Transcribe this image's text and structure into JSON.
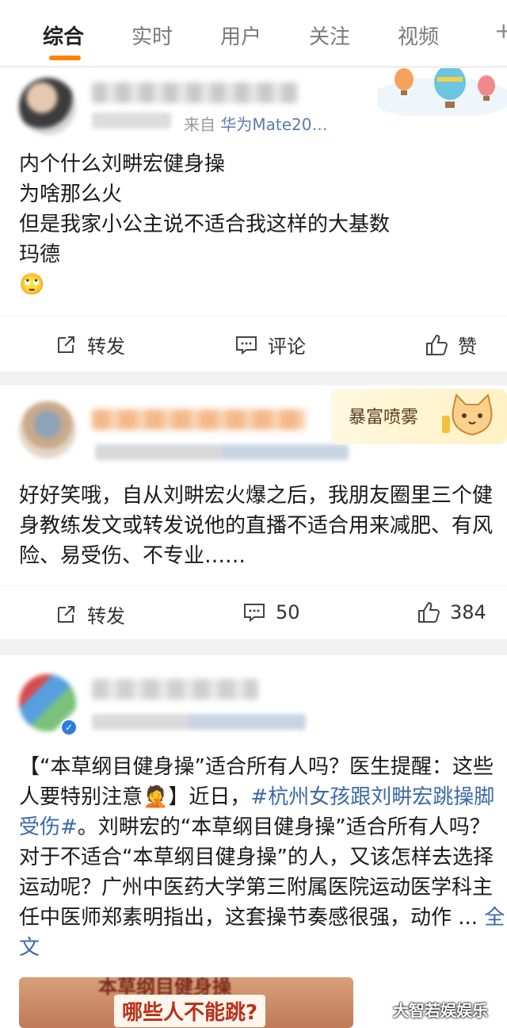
{
  "tabs": {
    "items": [
      {
        "label": "综合",
        "active": true
      },
      {
        "label": "实时",
        "active": false
      },
      {
        "label": "用户",
        "active": false
      },
      {
        "label": "关注",
        "active": false
      },
      {
        "label": "视频",
        "active": false
      }
    ],
    "accent": "#ff8200"
  },
  "posts": [
    {
      "meta_visible": "分钟前 · 来自 华为Mate20…",
      "meta_source": "华为Mate20…",
      "text": "内个什么刘畊宏健身操\n为啥那么火\n但是我家小公主说不适合我这样的大基数\n玛德",
      "emoji": "🙄",
      "decoration": "hot-air-balloons",
      "actions": {
        "repost": "转发",
        "comment": "评论",
        "like": "赞"
      }
    },
    {
      "text": "好好笑哦，自从刘畊宏火爆之后，我朋友圈里三个健身教练发文或转发说他的直播不适合用来减肥、有风险、易受伤、不专业……",
      "badge_text": "暴富喷雾",
      "actions": {
        "repost": "转发",
        "comment": "50",
        "like": "384"
      }
    },
    {
      "text_part1": "【“本草纲目健身操”适合所有人吗？医生提醒：这些人要特别注意",
      "text_emoji": "🤦",
      "text_part2": "】近日，",
      "hashtag": "#杭州女孩跟刘畊宏跳操脚受伤#",
      "text_part3": "。刘畊宏的“本草纲目健身操”适合所有人吗？对于不适合“本草纲目健身操”的人，又该怎样去选择运动呢？广州中医药大学第三附属医院运动医学科主任中医师郑素明指出，这套操节奏感很强，动作 ... ",
      "more": "全文",
      "thumb_line1": "本草纲目健身操",
      "thumb_line2": "哪些人不能跳?"
    }
  ],
  "watermark": "大智若娱娱乐"
}
